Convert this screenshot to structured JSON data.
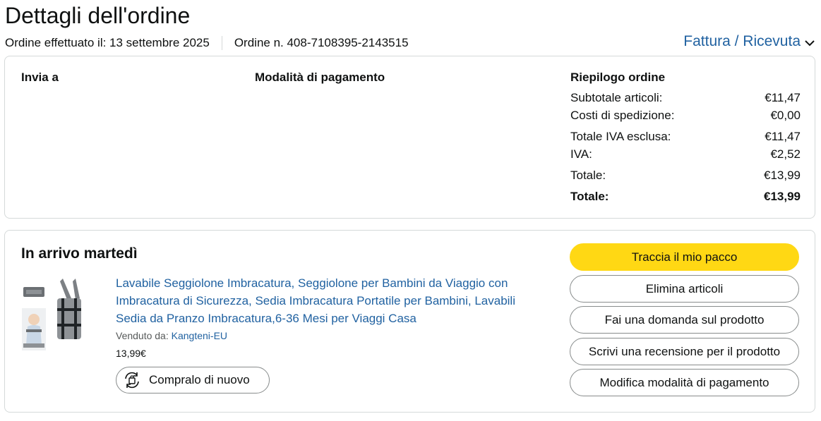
{
  "header": {
    "title": "Dettagli dell'ordine",
    "order_date": "Ordine effettuato il: 13 settembre 2025",
    "order_number": "Ordine n. 408-7108395-2143515",
    "invoice_link": "Fattura / Ricevuta"
  },
  "info": {
    "ship_to": "Invia a",
    "payment_method": "Modalità di pagamento",
    "summary_title": "Riepilogo ordine",
    "summary_rows": [
      {
        "label": "Subtotale articoli:",
        "value": "€11,47"
      },
      {
        "label": "Costi di spedizione:",
        "value": "€0,00"
      },
      {
        "label": "Totale IVA esclusa:",
        "value": "€11,47"
      },
      {
        "label": "IVA:",
        "value": "€2,52"
      },
      {
        "label": "Totale:",
        "value": "€13,99"
      },
      {
        "label": "Totale:",
        "value": "€13,99"
      }
    ]
  },
  "shipment": {
    "arrival": "In arrivo martedì",
    "product_title": "Lavabile Seggiolone Imbracatura, Seggiolone per Bambini da Viaggio con Imbracatura di Sicurezza, Sedia Imbracatura Portatile per Bambini, Lavabili Sedia da Pranzo Imbracatura,6-36 Mesi per Viaggi Casa",
    "sold_by_label": "Venduto da:",
    "seller": "Kangteni-EU",
    "price": "13,99€",
    "buy_again": "Compralo di nuovo",
    "actions": {
      "track": "Traccia il mio pacco",
      "delete": "Elimina articoli",
      "question": "Fai una domanda sul prodotto",
      "review": "Scrivi una recensione per il prodotto",
      "payment": "Modifica modalità di pagamento"
    }
  },
  "colors": {
    "link": "#2162a1",
    "primary_button": "#ffd814",
    "border": "#d5d9d9"
  }
}
